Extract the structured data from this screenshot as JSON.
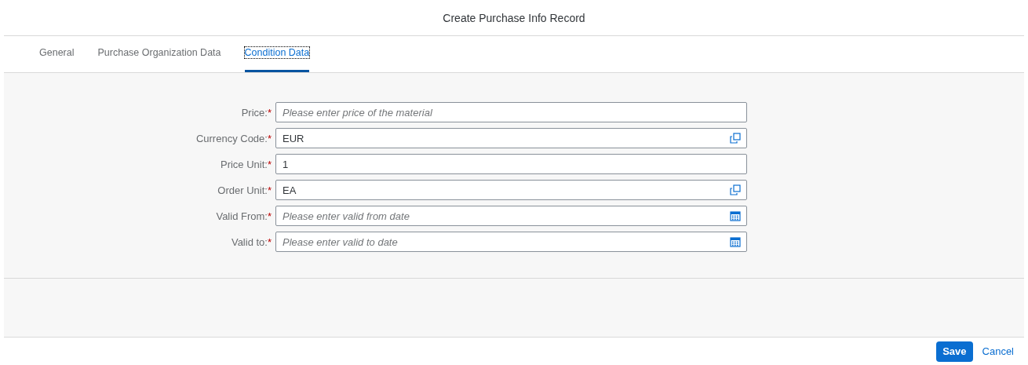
{
  "window": {
    "title": "Create Purchase Info Record"
  },
  "tabs": [
    {
      "label": "General",
      "selected": false
    },
    {
      "label": "Purchase Organization Data",
      "selected": false
    },
    {
      "label": "Condition Data",
      "selected": true
    }
  ],
  "required_marker": "*",
  "fields": [
    {
      "label": "Price:",
      "required": true,
      "kind": "text",
      "placeholder": "Please enter price of the material"
    },
    {
      "label": "Currency Code:",
      "required": true,
      "kind": "value-help",
      "value": "EUR"
    },
    {
      "label": "Price Unit:",
      "required": true,
      "kind": "text",
      "value": "1"
    },
    {
      "label": "Order Unit:",
      "required": true,
      "kind": "value-help",
      "value": "EA"
    },
    {
      "label": "Valid From:",
      "required": true,
      "kind": "date",
      "placeholder": "Please enter valid from date"
    },
    {
      "label": "Valid to:",
      "required": true,
      "kind": "date",
      "placeholder": "Please enter valid to date"
    }
  ],
  "footer": {
    "buttons": [
      {
        "label": "Save",
        "kind": "emphasized"
      },
      {
        "label": "Cancel",
        "kind": "transparent"
      }
    ]
  }
}
